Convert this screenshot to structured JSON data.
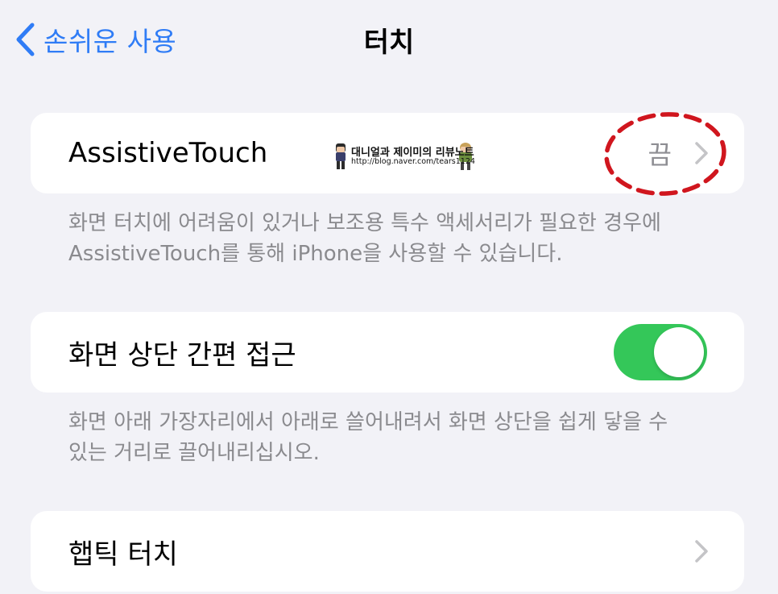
{
  "nav": {
    "back_label": "손쉬운 사용",
    "title": "터치"
  },
  "assistive": {
    "label": "AssistiveTouch",
    "value": "끔",
    "footer_line1": "화면 터치에 어려움이 있거나 보조용 특수 액세서리가 필요한 경우에",
    "footer_line2": "AssistiveTouch를 통해 iPhone을 사용할 수 있습니다."
  },
  "watermark": {
    "line1": "대니얼과 제이미의 리뷰노트",
    "line2": "http://blog.naver.com/tears1124"
  },
  "reachability": {
    "label": "화면 상단 간편 접근",
    "toggle_on": true,
    "footer_line1": "화면 아래 가장자리에서 아래로 쓸어내려서 화면 상단을 쉽게 닿을 수",
    "footer_line2": "있는 거리로 끌어내리십시오."
  },
  "haptic": {
    "label": "햅틱 터치"
  },
  "colors": {
    "accent": "#2f7cf6",
    "toggle_on": "#34c759",
    "annotation": "#d0161e",
    "background": "#f2f2f7"
  },
  "icons": {
    "back": "chevron-left-icon",
    "disclosure": "chevron-right-icon"
  }
}
